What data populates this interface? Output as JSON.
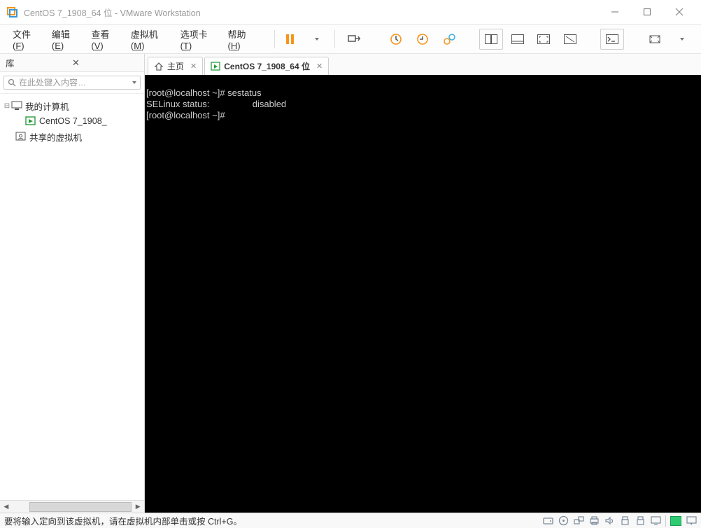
{
  "titlebar": {
    "title": "CentOS 7_1908_64 位 - VMware Workstation"
  },
  "menu": {
    "file": {
      "label": "文件",
      "hotkey": "F"
    },
    "edit": {
      "label": "编辑",
      "hotkey": "E"
    },
    "view": {
      "label": "查看",
      "hotkey": "V"
    },
    "vm": {
      "label": "虚拟机",
      "hotkey": "M"
    },
    "tabs": {
      "label": "选项卡",
      "hotkey": "T"
    },
    "help": {
      "label": "帮助",
      "hotkey": "H"
    }
  },
  "sidebar": {
    "title": "库",
    "search_placeholder": "在此处键入内容…",
    "tree": {
      "my_computer": "我的计算机",
      "vm_centos": "CentOS 7_1908_",
      "shared_vms": "共享的虚拟机"
    }
  },
  "tabs": {
    "home": "主页",
    "centos": "CentOS 7_1908_64 位"
  },
  "terminal": {
    "l1": "[root@localhost ~]# sestatus",
    "l2": "SELinux status:                 disabled",
    "l3": "[root@localhost ~]# "
  },
  "status": {
    "text": "要将输入定向到该虚拟机，请在虚拟机内部单击或按 Ctrl+G。"
  },
  "icons": {
    "app": "vmware-icon",
    "home": "home-icon",
    "vm": "vm-icon"
  }
}
